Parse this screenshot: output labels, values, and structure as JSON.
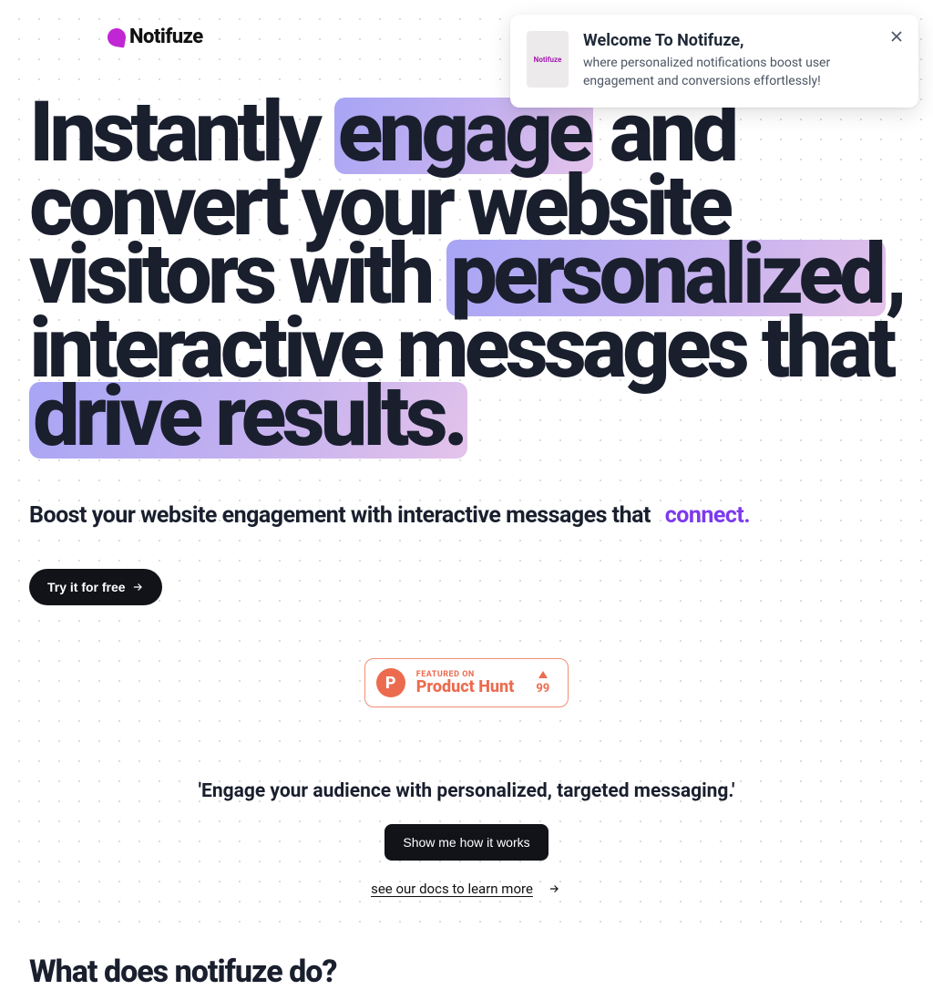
{
  "brand": "Notifuze",
  "notification": {
    "thumb_label": "Notifuze",
    "title": "Welcome To Notifuze,",
    "text": "where personalized notifications boost user engagement and conversions effortlessly!"
  },
  "hero": {
    "h1_part1": "Instantly ",
    "h1_hl1": "engage",
    "h1_part2": " and convert your website visitors with ",
    "h1_hl2": "personalized",
    "h1_part3": ", interactive messages that ",
    "h1_hl3": "drive results."
  },
  "subhead": {
    "text": "Boost your website engagement with interactive messages that ",
    "accent": "connect."
  },
  "cta_primary": "Try it for free",
  "product_hunt": {
    "featured": "FEATURED ON",
    "name": "Product Hunt",
    "count": "99",
    "p": "P"
  },
  "tagline": "'Engage your audience with personalized, targeted messaging.'",
  "cta_secondary": "Show me how it works",
  "docs_link": "see our docs to learn more",
  "section_heading": "What does notifuze do?"
}
